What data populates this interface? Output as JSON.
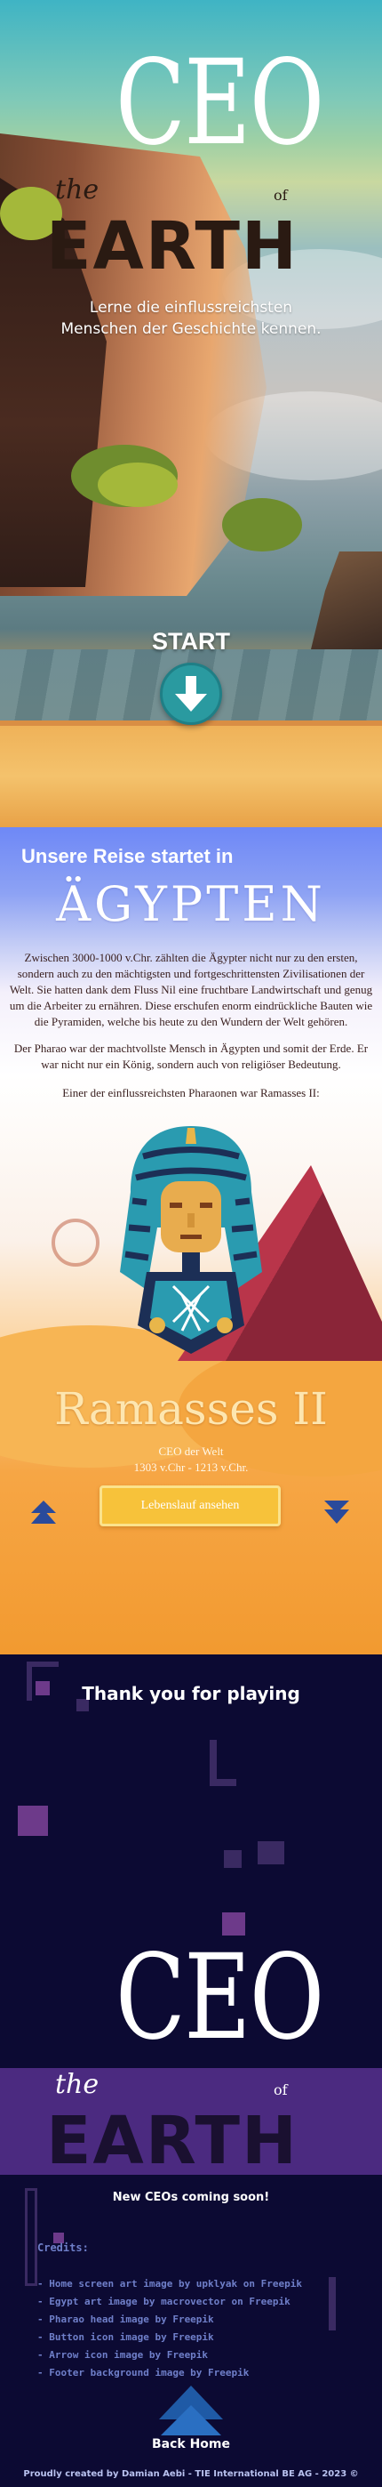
{
  "hero": {
    "logo": {
      "the": "the",
      "ceo": "CEO",
      "of": "of",
      "earth": "EARTH"
    },
    "tagline_line1": "Lerne die einflussreichsten",
    "tagline_line2": "Menschen der Geschichte kennen.",
    "start_label": "START",
    "start_icon": "arrow-down-icon"
  },
  "egypt": {
    "intro": "Unsere Reise startet in",
    "country": "ÄGYPTEN",
    "paragraph1": "Zwischen 3000-1000 v.Chr. zählten die Ägypter nicht nur zu den ersten, sondern auch zu den mächtigsten und fortgeschrittensten Zivilisationen der Welt. Sie hatten dank dem Fluss Nil eine fruchtbare Landwirtschaft und genug um die Arbeiter zu ernähren. Diese erschufen enorm eindrückliche Bauten wie die Pyramiden, welche bis heute zu den Wundern der Welt gehören.",
    "paragraph2": "Der Pharao war der machtvollste Mensch  in Ägypten und somit der Erde. Er war nicht nur ein König, sondern auch von religiöser Bedeutung.",
    "paragraph3": "Einer der einflussreichsten Pharaonen war Ramasses II:",
    "person": {
      "name": "Ramasses II",
      "title": "CEO der Welt",
      "years": "1303 v.Chr - 1213 v.Chr.",
      "button_label": "Lebenslauf ansehen"
    },
    "nav": {
      "prev_icon": "arrow-up-icon",
      "next_icon": "arrow-down-icon"
    },
    "colors": {
      "pyramid": "#b9354a",
      "button": "#f7c23a",
      "headdress": "#2a9bb0"
    }
  },
  "outro": {
    "thanks": "Thank you for playing",
    "logo": {
      "the": "the",
      "ceo": "CEO",
      "of": "of",
      "earth": "EARTH"
    },
    "coming": "New CEOs coming soon!",
    "credits_title": "Credits:",
    "credits": [
      "- Home screen art image by upklyak on Freepik",
      "- Egypt art image by macrovector on Freepik",
      "- Pharao head image by Freepik",
      "- Button icon image by Freepik",
      "- Arrow icon image by Freepik",
      "- Footer background image by Freepik"
    ],
    "back_label": "Back Home",
    "back_icon": "arrow-up-icon",
    "copyright": "Proudly created by Damian Aebi - TIE International BE AG - 2023 ©"
  }
}
